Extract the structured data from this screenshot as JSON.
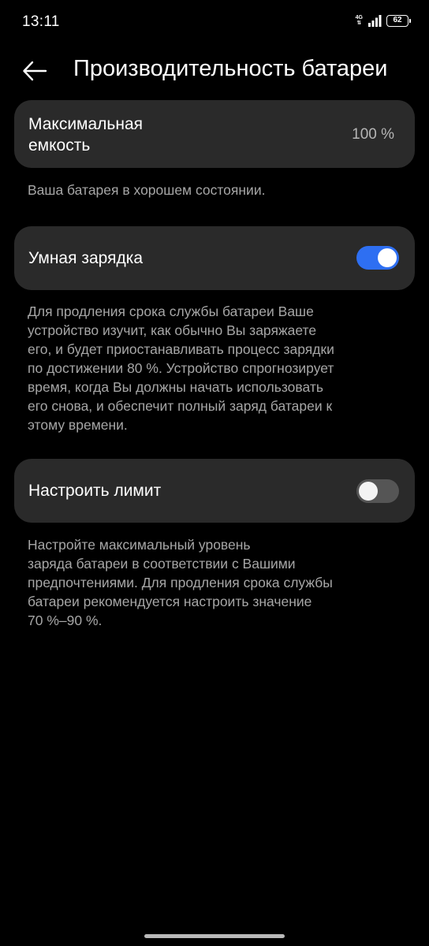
{
  "status_bar": {
    "time": "13:11",
    "network": "4G",
    "battery": "62"
  },
  "header": {
    "title": "Производительность батареи",
    "back_icon": "arrow-left-icon"
  },
  "capacity": {
    "label_line1": "Максимальная",
    "label_line2": "емкость",
    "value": "100 %",
    "description": "Ваша батарея в хорошем состоянии."
  },
  "smart_charging": {
    "label": "Умная зарядка",
    "enabled": true,
    "description_lines": [
      "Для продления срока службы батареи Ваше",
      "устройство изучит, как обычно Вы заряжаете",
      "его, и будет приостанавливать процесс зарядки",
      "по достижении 80 %. Устройство спрогнозирует",
      "время, когда Вы должны начать использовать",
      "его снова, и обеспечит полный заряд батареи к",
      "этому времени."
    ]
  },
  "charge_limit": {
    "label": "Настроить лимит",
    "enabled": false,
    "description_lines": [
      "Настройте максимальный уровень",
      "заряда батареи в соответствии с Вашими",
      "предпочтениями. Для продления срока службы",
      "батареи рекомендуется настроить значение",
      "70 %–90 %."
    ]
  },
  "colors": {
    "background": "#000000",
    "card": "#2a2a2a",
    "accent": "#2e6ff2",
    "secondary_text": "#a6a6a6"
  }
}
